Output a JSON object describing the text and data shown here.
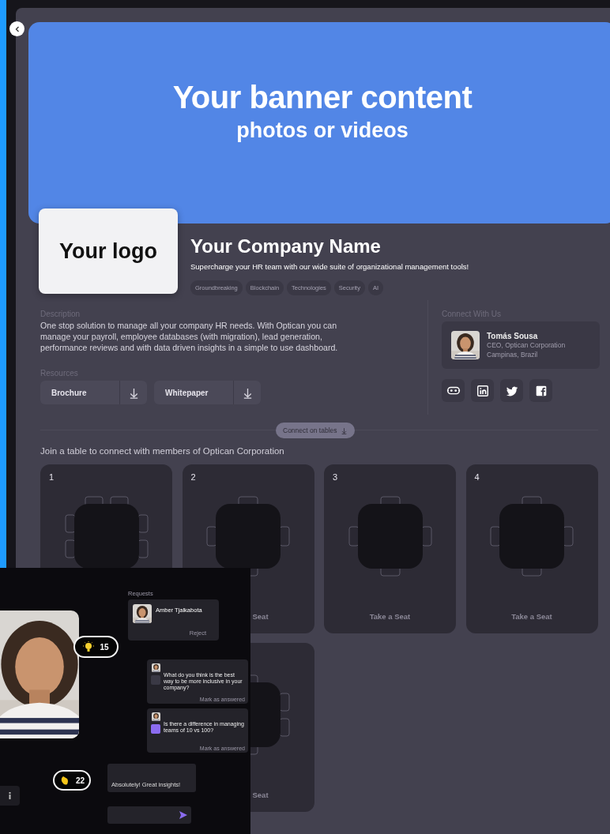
{
  "banner": {
    "title": "Your banner content",
    "subtitle": "photos or videos"
  },
  "logo": {
    "text": "Your logo"
  },
  "company": {
    "name": "Your Company Name",
    "tagline": "Supercharge your HR team with our wide suite of organizational management tools!",
    "tags": [
      "Groundbreaking",
      "Blockchain",
      "Technologies",
      "Security",
      "AI"
    ]
  },
  "description": {
    "label": "Description",
    "text": "One stop solution to manage all your company HR needs. With Optican you can manage your payroll, employee databases (with migration), lead generation, performance reviews and with data driven insights in a simple to use dashboard."
  },
  "resources": {
    "label": "Resources",
    "files": [
      "Brochure",
      "Whitepaper"
    ]
  },
  "connect": {
    "label": "Connect With Us",
    "contact": {
      "name": "Tomás Sousa",
      "role": "CEO, Optican Corporation",
      "location": "Campinas, Brazil"
    },
    "socials": [
      {
        "kind": "headset"
      },
      {
        "kind": "linkedin"
      },
      {
        "kind": "twitter"
      },
      {
        "kind": "facebook"
      }
    ]
  },
  "connect_tables_button": "Connect on tables",
  "tables": {
    "heading": "Join a table to connect with members of Optican Corporation",
    "items": [
      {
        "number": "1",
        "kind": "eight-seat"
      },
      {
        "number": "2",
        "kind": "four-seat",
        "label": "Seat",
        "cut_off": true
      },
      {
        "number": "3",
        "kind": "four-seat",
        "label": "Take a Seat",
        "cut_off": false
      },
      {
        "number": "4",
        "kind": "four-seat",
        "label": "Take a Seat",
        "cut_off": false
      },
      {
        "kind": "six-seat-partial",
        "label": "Seat",
        "cut_off": true
      }
    ]
  },
  "overlay": {
    "requests_label": "Requests",
    "request": {
      "name": "Amber Tjalkabota",
      "action": "Reject"
    },
    "reactions": [
      {
        "kind": "bulb",
        "count": "15"
      },
      {
        "kind": "clap",
        "count": "22"
      }
    ],
    "questions": [
      {
        "text": "What do you think is the best way to be more inclusive in your company?",
        "action": "Mark as answered",
        "accent": false
      },
      {
        "text": "Is there a difference in managing teams of 10 vs 100?",
        "action": "Mark as answered",
        "accent": true
      }
    ],
    "reply": "Absolutely! Great insights!"
  }
}
